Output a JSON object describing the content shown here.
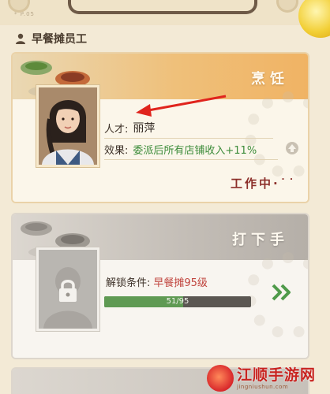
{
  "page_mark": "* P.05",
  "section": {
    "title": "早餐摊员工"
  },
  "cards": [
    {
      "title": "烹饪",
      "talent_label": "人才:",
      "talent_value": "丽萍",
      "effect_label": "效果:",
      "effect_value": "委派后所有店铺收入+11%",
      "status": "工作中·˙˙"
    },
    {
      "title": "打下手",
      "unlock_label": "解锁条件:",
      "unlock_value": "早餐摊95级",
      "progress_text": "51/95",
      "progress_current": 51,
      "progress_max": 95
    },
    {
      "title": ""
    }
  ],
  "watermark": {
    "name": "江顺手游网",
    "url": "jingniushun.com"
  },
  "colors": {
    "accent_green": "#3c8c3a",
    "status_red": "#8c2f2a",
    "unlock_red": "#c0443d",
    "progress_fill": "#5f9a53",
    "annotation_arrow": "#e0241d"
  },
  "icons": {
    "section": "person-icon",
    "effect_upgrade": "arrow-up-circle-icon",
    "locked_slot": "lock-icon",
    "go": "double-chevron-right-icon"
  }
}
